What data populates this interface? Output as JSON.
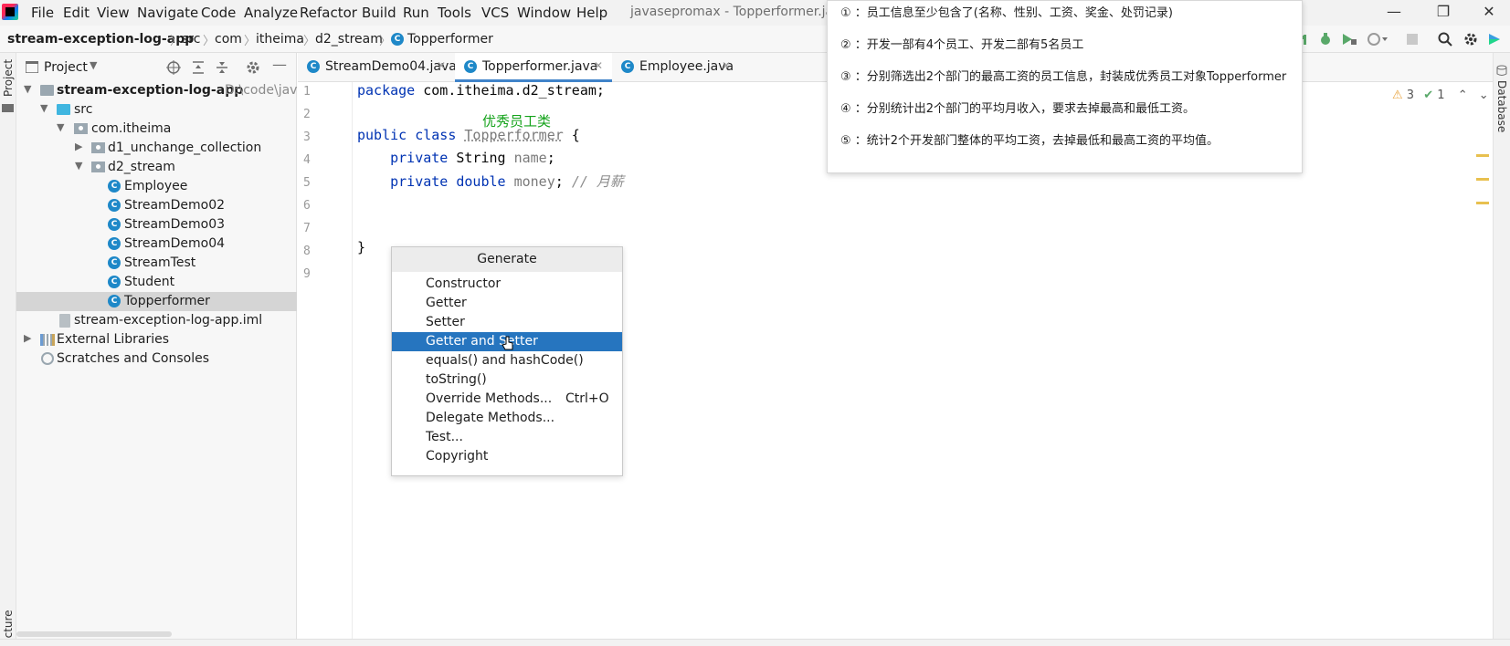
{
  "menu": {
    "items": [
      "File",
      "Edit",
      "View",
      "Navigate",
      "Code",
      "Analyze",
      "Refactor",
      "Build",
      "Run",
      "Tools",
      "VCS",
      "Window",
      "Help"
    ],
    "window_title": "javasepromax - Topperformer.java"
  },
  "breadcrumb": [
    "stream-exception-log-app",
    "src",
    "com",
    "itheima",
    "d2_stream",
    "Topperformer"
  ],
  "project_panel": {
    "title": "Project",
    "tree": [
      {
        "label": "stream-exception-log-app",
        "path": "D:\\code\\java"
      },
      {
        "label": "src"
      },
      {
        "label": "com.itheima"
      },
      {
        "label": "d1_unchange_collection"
      },
      {
        "label": "d2_stream"
      },
      {
        "label": "Employee"
      },
      {
        "label": "StreamDemo02"
      },
      {
        "label": "StreamDemo03"
      },
      {
        "label": "StreamDemo04"
      },
      {
        "label": "StreamTest"
      },
      {
        "label": "Student"
      },
      {
        "label": "Topperformer"
      },
      {
        "label": "stream-exception-log-app.iml"
      },
      {
        "label": "External Libraries"
      },
      {
        "label": "Scratches and Consoles"
      }
    ]
  },
  "side_stripes": {
    "left_top": "Project",
    "left_bottom": "ucture",
    "right": "Database"
  },
  "editor": {
    "tabs": [
      {
        "label": "StreamDemo04.java"
      },
      {
        "label": "Topperformer.java",
        "active": true
      },
      {
        "label": "Employee.java"
      }
    ],
    "line_numbers": [
      "1",
      "2",
      "3",
      "4",
      "5",
      "6",
      "7",
      "8",
      "9"
    ],
    "code": {
      "l1_kw": "package",
      "l1_rest": " com.itheima.d2_stream;",
      "l3_kw": "public class",
      "l3_name": "Topperformer",
      "l3_rest": " {",
      "l4_kw": "private",
      "l4_type": " String ",
      "l4_name": "name",
      "l4_rest": ";",
      "l5_kw": "private double",
      "l5_name": "money",
      "l5_rest": "; ",
      "l5_comment": "// 月薪",
      "l8": "}"
    },
    "annotation": "优秀员工类"
  },
  "generate_popup": {
    "title": "Generate",
    "items": [
      {
        "label": "Constructor"
      },
      {
        "label": "Getter"
      },
      {
        "label": "Setter"
      },
      {
        "label": "Getter and Setter",
        "selected": true
      },
      {
        "label": "equals() and hashCode()"
      },
      {
        "label": "toString()"
      },
      {
        "label": "Override Methods...",
        "shortcut": "Ctrl+O"
      },
      {
        "label": "Delegate Methods..."
      },
      {
        "label": "Test..."
      },
      {
        "label": "Copyright"
      }
    ]
  },
  "note": {
    "lines": [
      "① ：员工信息至少包含了(名称、性别、工资、奖金、处罚记录)",
      "② ：开发一部有4个员工、开发二部有5名员工",
      "③ ：分别筛选出2个部门的最高工资的员工信息，封装成优秀员工对象Topperformer",
      "④ ：分别统计出2个部门的平均月收入，要求去掉最高和最低工资。",
      "⑤ ：统计2个开发部门整体的平均工资，去掉最低和最高工资的平均值。"
    ]
  },
  "inspections": {
    "warnings": "3",
    "ok": "1"
  },
  "colors": {
    "selection": "#2675bf",
    "keyword": "#0033b3",
    "annotation": "#15a31b",
    "tab_underline": "#4083c9"
  }
}
